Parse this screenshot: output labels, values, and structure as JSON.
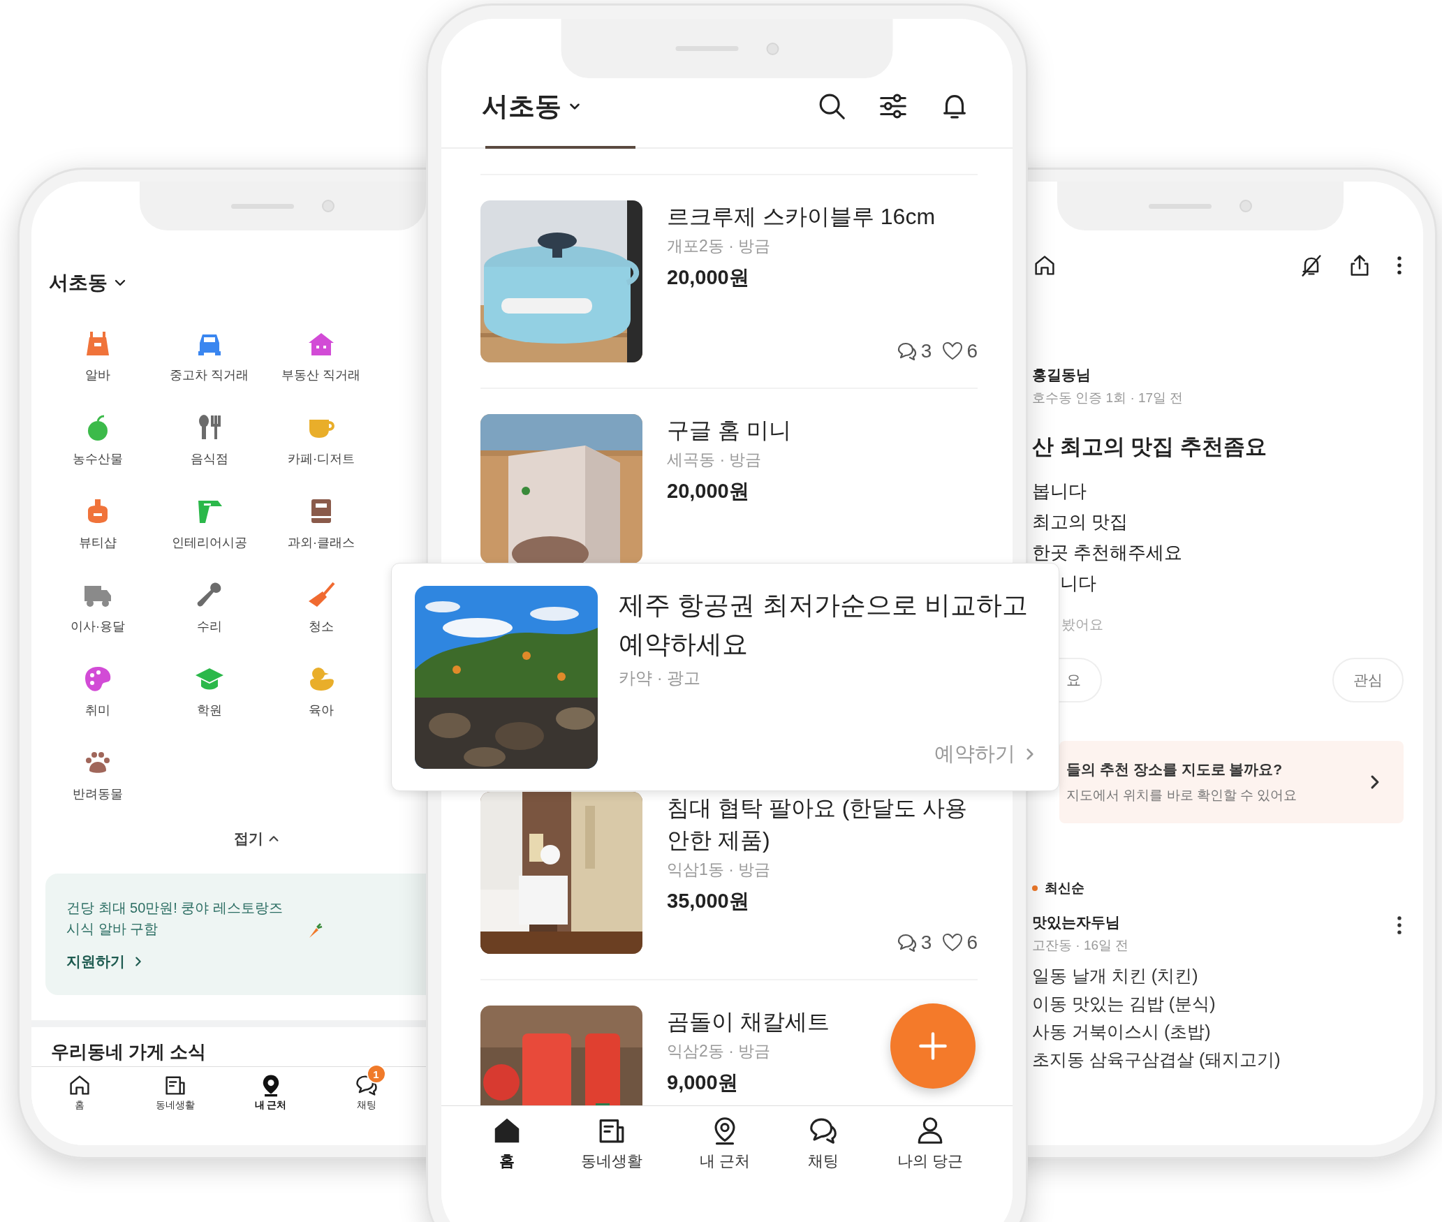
{
  "left_phone": {
    "location": "서초동",
    "categories": [
      {
        "label": "알바",
        "color": "#f0733a"
      },
      {
        "label": "중고차 직거래",
        "color": "#3a86f0"
      },
      {
        "label": "부동산 직거래",
        "color": "#d24bd6"
      },
      {
        "label": "농수산물",
        "color": "#3cba4a"
      },
      {
        "label": "음식점",
        "color": "#6b6b6b"
      },
      {
        "label": "카페·디저트",
        "color": "#e9ae2a"
      },
      {
        "label": "뷰티샵",
        "color": "#f0733a"
      },
      {
        "label": "인테리어시공",
        "color": "#2bb84a"
      },
      {
        "label": "과외·클래스",
        "color": "#8a5a4a"
      },
      {
        "label": "이사·용달",
        "color": "#8a8a8a"
      },
      {
        "label": "수리",
        "color": "#6b6b6b"
      },
      {
        "label": "청소",
        "color": "#f06a30"
      },
      {
        "label": "취미",
        "color": "#d24bd6"
      },
      {
        "label": "학원",
        "color": "#2bb84a"
      },
      {
        "label": "육아",
        "color": "#e9ae2a"
      },
      {
        "label": "반려동물",
        "color": "#a0665a"
      }
    ],
    "collapse_label": "접기",
    "banner": {
      "text": "건당 최대 50만원! 쿵야 레스토랑즈 시식 알바 구함",
      "link": "지원하기"
    },
    "section_title": "우리동네 가게 소식",
    "nav": [
      {
        "label": "홈",
        "selected": false
      },
      {
        "label": "동네생활",
        "selected": false
      },
      {
        "label": "내 근처",
        "selected": true
      },
      {
        "label": "채팅",
        "selected": false,
        "badge": "1"
      }
    ]
  },
  "center_phone": {
    "location": "서초동",
    "items": [
      {
        "title": "르크루제 스카이블루 16cm",
        "place_time": "개포2동 · 방금",
        "price": "20,000원",
        "comments": "3",
        "likes": "6"
      },
      {
        "title": "구글 홈 미니",
        "place_time": "세곡동 · 방금",
        "price": "20,000원"
      },
      {
        "title": "침대 협탁 팔아요 (한달도 사용 안한 제품)",
        "place_time": "익삼1동 · 방금",
        "price": "35,000원",
        "comments": "3",
        "likes": "6"
      },
      {
        "title": "곰돌이 채칼세트",
        "place_time": "익삼2동 · 방금",
        "price": "9,000원"
      }
    ],
    "nav": [
      {
        "label": "홈",
        "selected": true
      },
      {
        "label": "동네생활",
        "selected": false
      },
      {
        "label": "내 근처",
        "selected": false
      },
      {
        "label": "채팅",
        "selected": false
      },
      {
        "label": "나의 당근",
        "selected": false
      }
    ]
  },
  "ad_card": {
    "title": "제주 항공권 최저가순으로 비교하고 예약하세요",
    "source": "카약 · 광고",
    "action": "예약하기"
  },
  "right_phone": {
    "author": "홍길동님",
    "meta": "호수동 인증 1회 · 17일 전",
    "title": "산 최고의 맛집 추천좀요",
    "body_lines": [
      "봅니다",
      "최고의 맛집",
      "한곳 추천해주세요",
      "니다"
    ],
    "note": "봤어요",
    "buttons": [
      "요",
      "관심"
    ],
    "map_banner": {
      "title": "들의 추천 장소를 지도로 볼까요?",
      "subtitle": "지도에서 위치를 바로 확인할 수 있어요"
    },
    "sort_label": "최신순",
    "comment": {
      "author": "맛있는자두님",
      "meta": "고잔동 · 16일 전",
      "lines": [
        "일동 날개 치킨 (치킨)",
        "이동 맛있는 김밥 (분식)",
        "사동 거북이스시 (초밥)",
        "초지동 삼육구삼겹살 (돼지고기)"
      ]
    }
  }
}
